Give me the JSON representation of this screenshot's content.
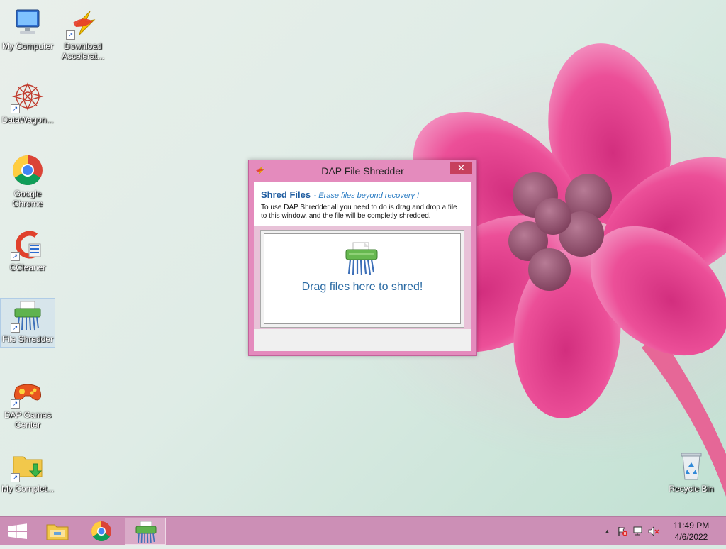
{
  "desktop": {
    "icons": [
      {
        "label": "My Computer"
      },
      {
        "label": "Download Accelerat..."
      },
      {
        "label": "DataWagon..."
      },
      {
        "label": "Google Chrome"
      },
      {
        "label": "CCleaner"
      },
      {
        "label": "File Shredder"
      },
      {
        "label": "DAP Games Center"
      },
      {
        "label": "My Complet..."
      },
      {
        "label": "Recycle Bin"
      }
    ]
  },
  "dialog": {
    "title": "DAP File Shredder",
    "close_glyph": "✕",
    "heading": "Shred Files",
    "subheading": "- Erase files beyond recovery !",
    "description": "To use DAP Shredder,all you need to do is drag and drop a file to this window, and the file will be completly shredded.",
    "drop_text": "Drag files here to shred!"
  },
  "taskbar": {
    "apps": [
      "File Explorer",
      "Google Chrome",
      "File Shredder"
    ],
    "tray_arrow": "▲",
    "time": "11:49 PM",
    "date": "4/6/2022"
  },
  "colors": {
    "accent": "#cc8fb6",
    "dialog_frame": "#e48bbd",
    "close_button": "#c7405d",
    "heading_blue": "#1d5b9f"
  }
}
